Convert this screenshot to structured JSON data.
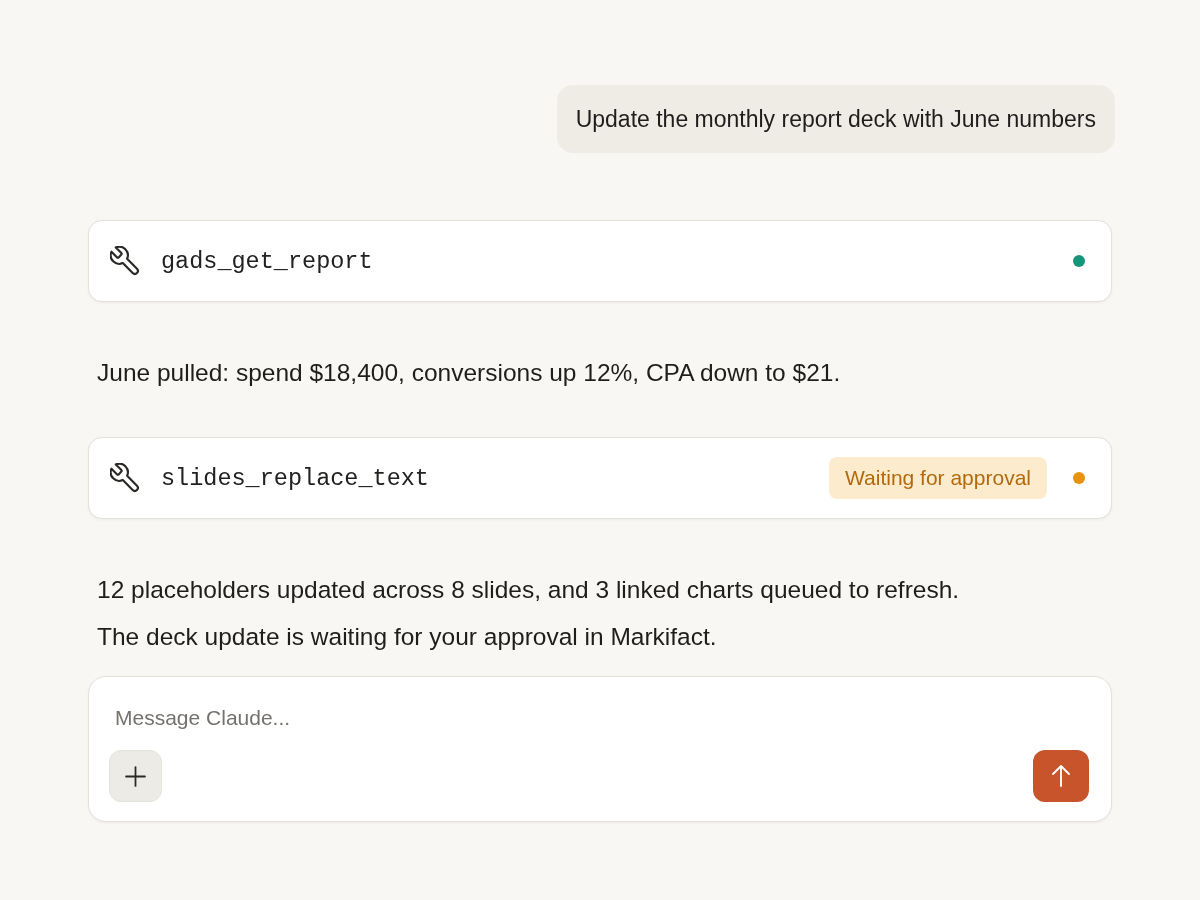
{
  "user_message": {
    "text": "Update the monthly report deck with June numbers"
  },
  "transcript": [
    {
      "kind": "tool_call",
      "name": "gads_get_report",
      "color": "#15967b"
    },
    {
      "kind": "text",
      "paragraphs": [
        "June pulled: spend $18,400, conversions up 12%, CPA down to $21."
      ]
    },
    {
      "kind": "tool_call",
      "name": "slides_replace_text",
      "badge": "Waiting for approval",
      "color": "#e8920f"
    },
    {
      "kind": "text",
      "paragraphs": [
        "12 placeholders updated across 8 slides, and 3 linked charts queued to refresh.",
        "The deck update is waiting for your approval in Markifact."
      ]
    }
  ],
  "composer": {
    "placeholder": "Message Claude..."
  }
}
